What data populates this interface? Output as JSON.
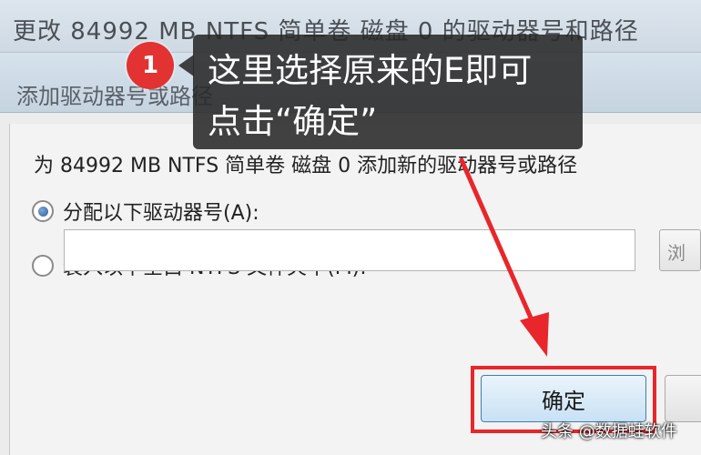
{
  "window": {
    "title": "更改 84992 MB NTFS 简单卷 磁盘 0 的驱动器号和路径"
  },
  "dialog": {
    "title": "添加驱动器号或路径",
    "description": "为 84992 MB NTFS 简单卷 磁盘 0 添加新的驱动器号或路径",
    "option_assign_label": "分配以下驱动器号(A):",
    "option_mount_label": "装入以下空白 NTFS 文件夹中(M):",
    "option_assign_selected": true,
    "path_value": "",
    "browse_label": "浏",
    "ok_label": "确定"
  },
  "annotation": {
    "step_number": "1",
    "line1": "这里选择原来的E即可",
    "line2": "点击“确定”",
    "highlight_color": "#e8262b"
  },
  "watermark": "头条 @数据蛙软件"
}
